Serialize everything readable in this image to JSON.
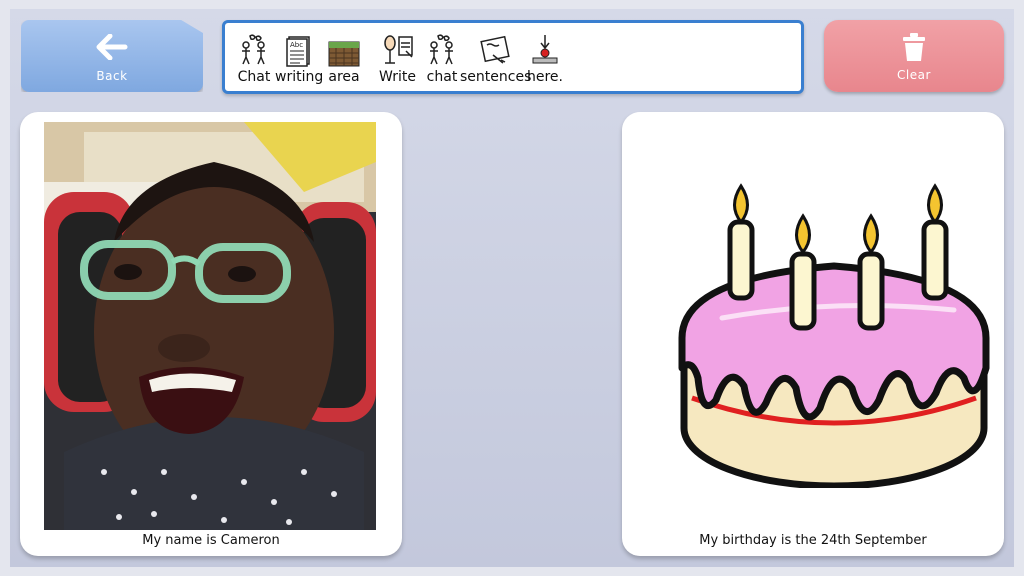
{
  "toolbar": {
    "back_label": "Back",
    "clear_label": "Clear"
  },
  "chat_bar": {
    "words": [
      {
        "text": "Chat",
        "symbol": "two-people-talking-icon"
      },
      {
        "text": "writing",
        "symbol": "document-icon"
      },
      {
        "text": "area",
        "symbol": "field-area-icon"
      },
      {
        "text": "Write",
        "symbol": "person-writing-icon"
      },
      {
        "text": "chat",
        "symbol": "two-people-talking-icon"
      },
      {
        "text": "sentences",
        "symbol": "sentence-paper-icon"
      },
      {
        "text": "here.",
        "symbol": "here-pointer-icon"
      }
    ]
  },
  "cards": [
    {
      "caption": "My name is Cameron",
      "image": "photo-boy-smiling"
    },
    {
      "caption": "My birthday is the 24th September",
      "image": "birthday-cake-icon"
    }
  ],
  "colors": {
    "back": "#8fb4e6",
    "clear": "#ec9097",
    "chat_border": "#3a7fd0",
    "cake_icing": "#f0a0e0"
  }
}
